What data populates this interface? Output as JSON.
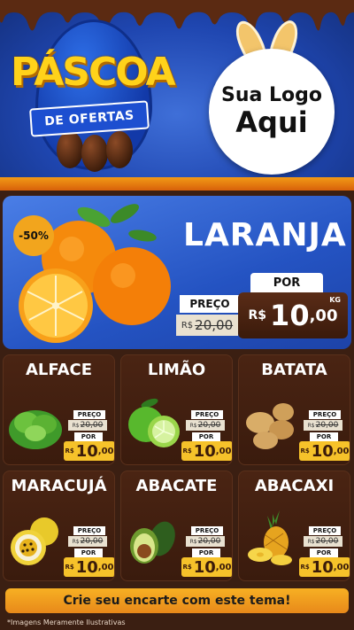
{
  "header": {
    "title": "PÁSCOA",
    "subtitle": "DE OFERTAS",
    "logo_line1": "Sua Logo",
    "logo_line2": "Aqui"
  },
  "featured": {
    "name": "LARANJA",
    "discount": "-50%",
    "preco_label": "PREÇO",
    "old_currency": "R$",
    "old_price": "20,00",
    "por_label": "POR",
    "new_currency": "R$",
    "new_price_int": "10",
    "new_price_dec": ",00",
    "unit": "KG"
  },
  "products": [
    {
      "name": "ALFACE",
      "preco_label": "PREÇO",
      "old_currency": "R$",
      "old_price": "20,00",
      "por_label": "POR",
      "new_currency": "R$",
      "new_int": "10",
      "new_dec": ",00",
      "icon": "lettuce-icon"
    },
    {
      "name": "LIMÃO",
      "preco_label": "PREÇO",
      "old_currency": "R$",
      "old_price": "20,00",
      "por_label": "POR",
      "new_currency": "R$",
      "new_int": "10",
      "new_dec": ",00",
      "icon": "lime-icon"
    },
    {
      "name": "BATATA",
      "preco_label": "PREÇO",
      "old_currency": "R$",
      "old_price": "20,00",
      "por_label": "POR",
      "new_currency": "R$",
      "new_int": "10",
      "new_dec": ",00",
      "icon": "potato-icon"
    },
    {
      "name": "MARACUJÁ",
      "preco_label": "PREÇO",
      "old_currency": "R$",
      "old_price": "20,00",
      "por_label": "POR",
      "new_currency": "R$",
      "new_int": "10",
      "new_dec": ",00",
      "icon": "passionfruit-icon"
    },
    {
      "name": "ABACATE",
      "preco_label": "PREÇO",
      "old_currency": "R$",
      "old_price": "20,00",
      "por_label": "POR",
      "new_currency": "R$",
      "new_int": "10",
      "new_dec": ",00",
      "icon": "avocado-icon"
    },
    {
      "name": "ABACAXI",
      "preco_label": "PREÇO",
      "old_currency": "R$",
      "old_price": "20,00",
      "por_label": "POR",
      "new_currency": "R$",
      "new_int": "10",
      "new_dec": ",00",
      "icon": "pineapple-icon"
    }
  ],
  "cta": "Crie seu encarte com este tema!",
  "disclaimer": "*Imagens Meramente Ilustrativas",
  "colors": {
    "header_blue": "#1f46b0",
    "title_yellow": "#ffd21a",
    "card_brown": "#4a2413",
    "price_yellow": "#f6c22a",
    "cta_orange": "#f7b023"
  }
}
